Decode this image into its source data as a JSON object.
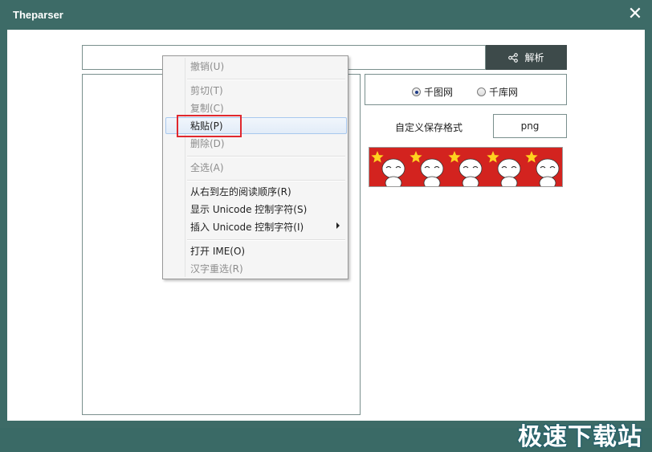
{
  "window": {
    "title": "Theparser"
  },
  "toolbar": {
    "parse_label": "解析",
    "url_value": ""
  },
  "options": {
    "radios": [
      {
        "label": "千图网",
        "checked": true
      },
      {
        "label": "千库网",
        "checked": false
      }
    ],
    "format_label": "自定义保存格式",
    "format_value": "png"
  },
  "context_menu": {
    "items": [
      {
        "label": "撤销(U)",
        "enabled": false
      },
      {
        "label": "剪切(T)",
        "enabled": false
      },
      {
        "label": "复制(C)",
        "enabled": false
      },
      {
        "label": "粘贴(P)",
        "enabled": true,
        "highlighted": true
      },
      {
        "label": "删除(D)",
        "enabled": false
      },
      {
        "label": "全选(A)",
        "enabled": false
      },
      {
        "label": "从右到左的阅读顺序(R)",
        "enabled": true
      },
      {
        "label": "显示 Unicode 控制字符(S)",
        "enabled": true
      },
      {
        "label": "插入 Unicode 控制字符(I)",
        "enabled": true,
        "submenu": true
      },
      {
        "label": "打开 IME(O)",
        "enabled": true
      },
      {
        "label": "汉字重选(R)",
        "enabled": false
      }
    ]
  },
  "watermark": "极速下载站",
  "colors": {
    "titlebar": "#3d6b67",
    "button": "#3d4a4a",
    "highlight_box": "#e0282e",
    "preview_bg": "#d3231f"
  }
}
